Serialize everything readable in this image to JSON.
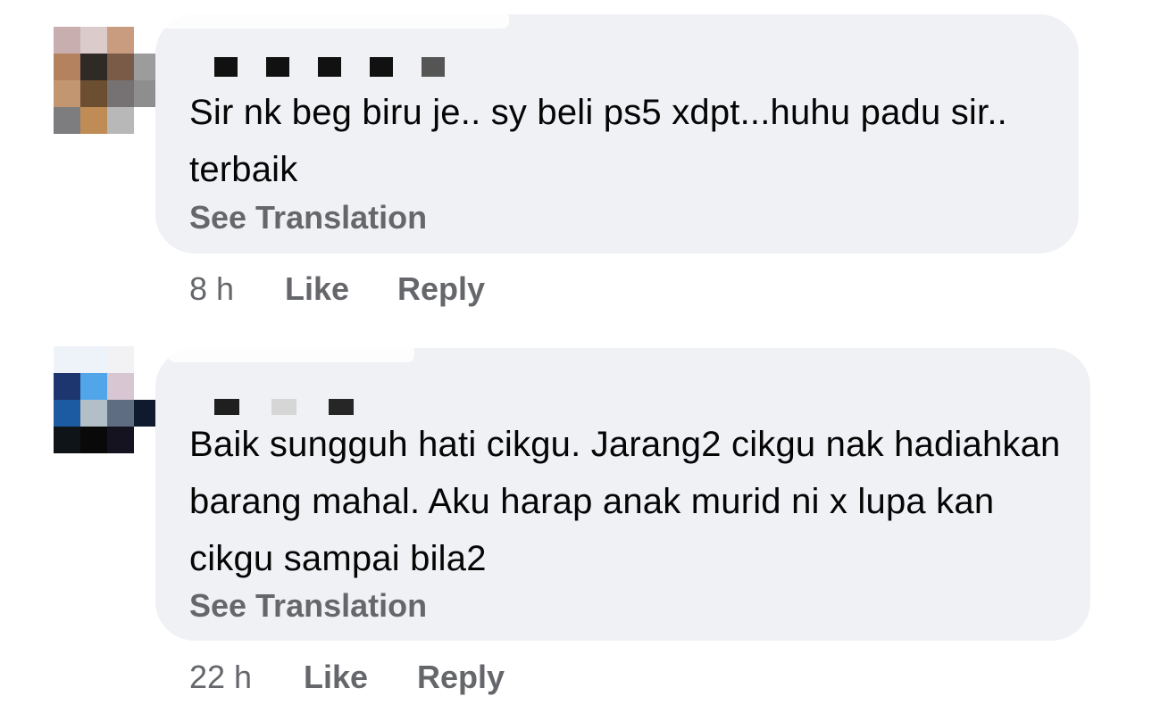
{
  "comments": [
    {
      "avatar_name": "blurred-avatar-1",
      "avatar_colors": [
        [
          "#c9aeb0",
          "#dccbcb",
          "#c99c80",
          "#ffffff"
        ],
        [
          "#b5825f",
          "#2f2a26",
          "#7a5b48",
          "#9c9c9c"
        ],
        [
          "#c19670",
          "#6b4f30",
          "#767273",
          "#8e8e8e"
        ],
        [
          "#7d7d80",
          "#c08c56",
          "#b8b8b8",
          "#ffffff"
        ]
      ],
      "name_block_colors": [
        "#111111",
        "#111111",
        "#111111",
        "#111111",
        "#555555"
      ],
      "text": "Sir nk beg biru je.. sy beli ps5 xdpt...huhu padu sir.. terbaik",
      "see_translation": "See Translation",
      "time": "8 h",
      "like": "Like",
      "reply": "Reply"
    },
    {
      "avatar_name": "blurred-avatar-2",
      "avatar_colors": [
        [
          "#eef3fa",
          "#eef3fa",
          "#f2f2f4",
          "#ffffff"
        ],
        [
          "#1d3670",
          "#51a6e9",
          "#d8c7d3",
          "#ffffff"
        ],
        [
          "#1c5aa1",
          "#b3bfc6",
          "#5f6d82",
          "#101a2e"
        ],
        [
          "#0f1419",
          "#090909",
          "#161320",
          "#ffffff"
        ]
      ],
      "name_block_colors": [
        "#1f1f1f",
        "#d6d6d6",
        "#262626"
      ],
      "text": "Baik sungguh hati cikgu. Jarang2 cikgu nak hadiahkan barang mahal. Aku harap anak murid ni x lupa kan cikgu sampai bila2",
      "see_translation": "See Translation",
      "time": "22 h",
      "like": "Like",
      "reply": "Reply"
    }
  ]
}
